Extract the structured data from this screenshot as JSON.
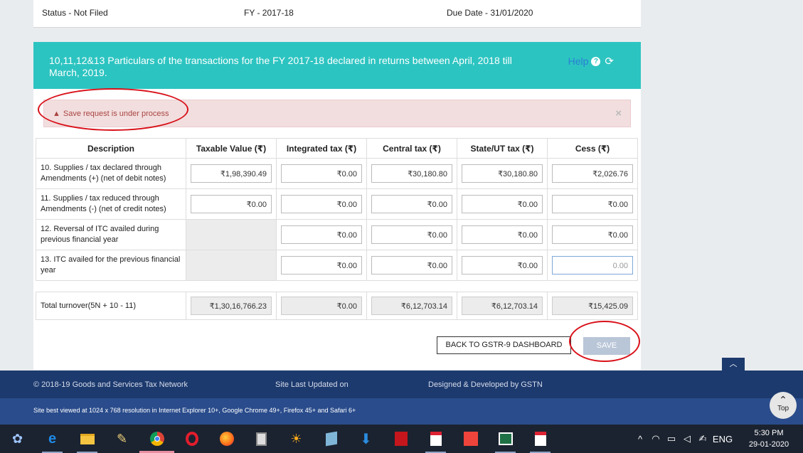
{
  "top_bar": {
    "status": "Status - Not Filed",
    "fy": "FY - 2017-18",
    "due_date": "Due Date - 31/01/2020"
  },
  "panel": {
    "title": "10,11,12&13 Particulars of the transactions for the FY 2017-18 declared in returns between April, 2018 till March, 2019.",
    "help_label": "Help",
    "help_icon": "question-circle-icon",
    "refresh_icon": "refresh-icon"
  },
  "alert": {
    "message": "Save request is under process",
    "icon": "warning-triangle-icon",
    "close_symbol": "×"
  },
  "table": {
    "headers": [
      "Description",
      "Taxable Value (₹)",
      "Integrated tax (₹)",
      "Central tax (₹)",
      "State/UT tax (₹)",
      "Cess (₹)"
    ],
    "rows": [
      {
        "description": "10. Supplies / tax declared through Amendments (+) (net of debit notes)",
        "taxable_value": "₹1,98,390.49",
        "integrated_tax": "₹0.00",
        "central_tax": "₹30,180.80",
        "state_tax": "₹30,180.80",
        "cess": "₹2,026.76"
      },
      {
        "description": "11. Supplies / tax reduced through Amendments (-) (net of credit notes)",
        "taxable_value": "₹0.00",
        "integrated_tax": "₹0.00",
        "central_tax": "₹0.00",
        "state_tax": "₹0.00",
        "cess": "₹0.00"
      },
      {
        "description": "12. Reversal of ITC availed during previous financial year",
        "integrated_tax": "₹0.00",
        "central_tax": "₹0.00",
        "state_tax": "₹0.00",
        "cess": "₹0.00"
      },
      {
        "description": "13. ITC availed for the previous financial year",
        "integrated_tax": "₹0.00",
        "central_tax": "₹0.00",
        "state_tax": "₹0.00",
        "cess": "0.00"
      }
    ],
    "total": {
      "description": "Total turnover(5N + 10 - 11)",
      "taxable_value": "₹1,30,16,766.23",
      "integrated_tax": "₹0.00",
      "central_tax": "₹6,12,703.14",
      "state_tax": "₹6,12,703.14",
      "cess": "₹15,425.09"
    }
  },
  "buttons": {
    "back": "BACK TO GSTR-9 DASHBOARD",
    "save": "SAVE"
  },
  "scroll_top_symbol": "︿",
  "footer": {
    "copyright": "© 2018-19 Goods and Services Tax Network",
    "updated": "Site Last Updated on",
    "designed": "Designed & Developed by GSTN",
    "browser_note": "Site best viewed at 1024 x 768 resolution in Internet Explorer 10+, Google Chrome 49+, Firefox 45+ and Safari 6+",
    "top_label": "Top"
  },
  "taskbar": {
    "language": "ENG",
    "time": "5:30 PM",
    "date": "29-01-2020"
  },
  "colors": {
    "header_teal": "#2cc4c1",
    "footer_navy": "#1c3a6e",
    "alert_bg": "#f2dede",
    "annotation_red": "#d9111a"
  }
}
